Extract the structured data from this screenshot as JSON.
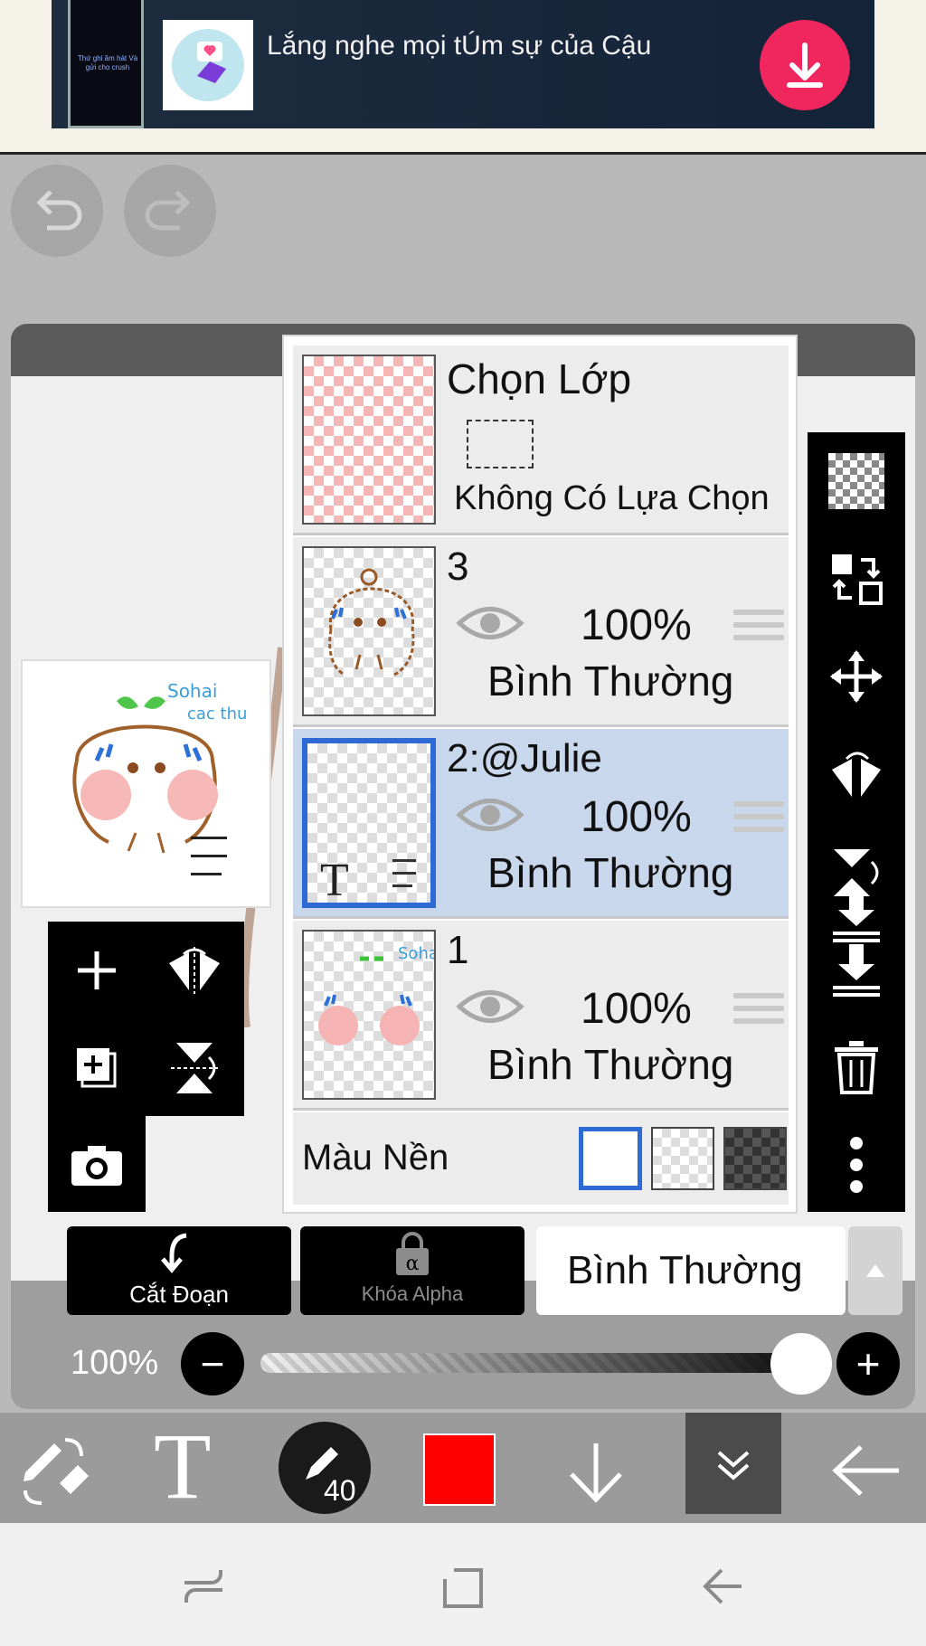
{
  "ad": {
    "phone_text": "Thứ ghi âm hát Và gửi cho crush",
    "title": "Lắng nghe mọi tÚm sự của Cậu",
    "download_icon": "download-icon",
    "accent": "#f0265e"
  },
  "toolbar_top": {
    "undo_icon": "undo-icon",
    "redo_icon": "redo-icon"
  },
  "preview": {
    "text_green": "Sohai",
    "text_blue": "cac thu"
  },
  "layers": {
    "selection": {
      "title": "Chọn Lớp",
      "subtitle": "Không Có Lựa Chọn"
    },
    "items": [
      {
        "name": "3",
        "opacity": "100%",
        "blend": "Bình Thường",
        "selected": false
      },
      {
        "name": "2:@Julie",
        "opacity": "100%",
        "blend": "Bình Thường",
        "selected": true,
        "thumb_letter": "T"
      },
      {
        "name": "1",
        "opacity": "100%",
        "blend": "Bình Thường",
        "selected": false
      }
    ],
    "background": {
      "label": "Màu Nền",
      "options": [
        "white",
        "transparent",
        "dark-checker"
      ],
      "selected": "white"
    }
  },
  "actions": {
    "clipping": "Cắt Đoạn",
    "alpha_lock": "Khóa Alpha",
    "alpha_symbol": "α",
    "blend_mode": "Bình Thường"
  },
  "opacity": {
    "label": "100%",
    "value": 1.0,
    "minus": "−",
    "plus": "+"
  },
  "brush": {
    "size": "40",
    "color": "#ff0000"
  },
  "colors": {
    "selected_highlight": "#2e6ad3",
    "selected_row": "#c8d7ec"
  }
}
